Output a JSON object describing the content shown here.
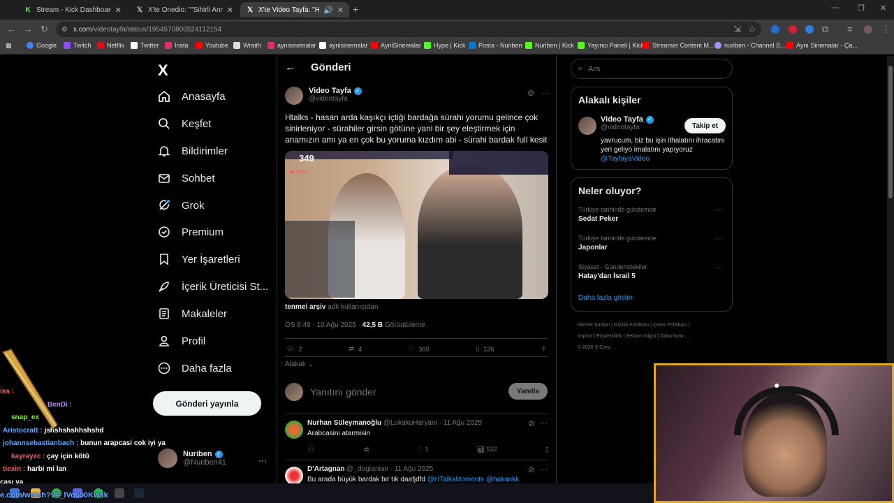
{
  "browser": {
    "tabs": [
      {
        "label": "Stream - Kick Dashboard",
        "favicon": "kick-icon",
        "active": false
      },
      {
        "label": "X'te Onedio: \"\"Sihirli Annem\"in",
        "favicon": "x-icon",
        "active": false
      },
      {
        "label": "X'te Video Tayfa: \"Htalks - h",
        "favicon": "x-icon",
        "active": true
      }
    ],
    "new_tab": "+",
    "url_host": "x.com",
    "url_path": "/videotayfa/status/1954570800524112154",
    "bookmarks": [
      {
        "label": "Google",
        "color": "#4285f4"
      },
      {
        "label": "Twitch",
        "color": "#9146ff"
      },
      {
        "label": "Netflix",
        "color": "#e50914"
      },
      {
        "label": "Twitter",
        "color": "#ffffff"
      },
      {
        "label": "Insta",
        "color": "#e1306c"
      },
      {
        "label": "Youtube",
        "color": "#ff0000"
      },
      {
        "label": "Wraith",
        "color": "#dddddd"
      },
      {
        "label": "aynisinemalar",
        "color": "#e1306c"
      },
      {
        "label": "aynisinemalar",
        "color": "#ffffff"
      },
      {
        "label": "AyniSinemalar",
        "color": "#ff0000"
      },
      {
        "label": "Hype | Kick",
        "color": "#53fc18"
      },
      {
        "label": "Posta - Nuriben",
        "color": "#0078d4"
      },
      {
        "label": "Nuriben | Kick",
        "color": "#53fc18"
      },
      {
        "label": "Yayıncı Paneli | Kick",
        "color": "#53fc18"
      },
      {
        "label": "Streamer Content M...",
        "color": "#ff0000"
      },
      {
        "label": "nuriben - Channel S...",
        "color": "#9999ff"
      },
      {
        "label": "Aynı Sinemalar - Ça...",
        "color": "#ff0000"
      }
    ]
  },
  "sidebar": {
    "logo": "X",
    "items": [
      {
        "label": "Anasayfa",
        "icon": "home-icon"
      },
      {
        "label": "Keşfet",
        "icon": "search-icon"
      },
      {
        "label": "Bildirimler",
        "icon": "bell-icon"
      },
      {
        "label": "Sohbet",
        "icon": "mail-icon"
      },
      {
        "label": "Grok",
        "icon": "grok-icon"
      },
      {
        "label": "Premium",
        "icon": "premium-icon"
      },
      {
        "label": "Yer İşaretleri",
        "icon": "bookmark-icon"
      },
      {
        "label": "İçerik Üreticisi St...",
        "icon": "rocket-icon"
      },
      {
        "label": "Makaleler",
        "icon": "article-icon"
      },
      {
        "label": "Profil",
        "icon": "person-icon"
      },
      {
        "label": "Daha fazla",
        "icon": "more-circle-icon"
      }
    ],
    "post_button": "Gönderi yayınla",
    "account": {
      "name": "Nuriben",
      "handle": "@Nuriben41"
    }
  },
  "main": {
    "header": "Gönderi",
    "tweet": {
      "author": "Video Tayfa",
      "handle": "@videotayfa",
      "text": "Htalks - hasan arda kaşıkçı içtiği bardağa sürahi yorumu gelince çok sinirleniyor - sürahiler girsin götüne yani bir şey eleştirmek için anamızın amı ya en çok bu yoruma kızdım abi - sürahi bardak full kesit",
      "media_viewers": "349",
      "media_by_name": "tenmei arşiv",
      "media_by_suffix": "adlı kullanıcıdan",
      "time": "ÖS 6:49 · 10 Ağu 2025 · ",
      "views": "42,5 B",
      "views_label": "Görüntüleme",
      "replies": "2",
      "reposts": "4",
      "likes": "360",
      "bookmarks": "126"
    },
    "sort": "Alakalı",
    "reply_placeholder": "Yanıtını gönder",
    "reply_button": "Yanıtla",
    "replies": [
      {
        "name": "Nurhan Süleymanoğlu",
        "handle": "@LukakuHaryani · 11 Ağu 2025",
        "text": "Arabcasini atarmisin",
        "replies": "",
        "reposts": "",
        "likes": "1",
        "views": "532"
      },
      {
        "name": "D'Artagnan",
        "handle": "@_dogtanian · 11 Ağu 2025",
        "text": "Bu arada büyük bardak bir tık daafjdfd ",
        "link": "@HTalksMoments @hakankk"
      }
    ]
  },
  "right": {
    "search_placeholder": "Ara",
    "related_title": "Alakalı kişiler",
    "related": {
      "name": "Video Tayfa",
      "handle": "@videotayfa",
      "follow": "Takip et",
      "bio": "yavrucum, biz bu işin ithalatını ihracatını yeri geliyo imalatını yapıyoruz ",
      "bio_link": "@TayfayaVideo"
    },
    "trends_title": "Neler oluyor?",
    "trends": [
      {
        "context": "Türkiye tarihinde gündemde",
        "name": "Sedat Peker"
      },
      {
        "context": "Türkiye tarihinde gündemde",
        "name": "Japonlar"
      },
      {
        "context": "Siyaset · Gündemdekiler",
        "name": "Hatay'dan İsrail 5"
      }
    ],
    "show_more": "Daha fazla göster",
    "footer_line1": "Hizmet Şartları  |  Gizlilik Politikası  |  Çerez Politikası  |",
    "footer_line2": "Imprint  |  Erişilebilirlik  |  Reklam bilgisi  |  Daha fazla ...",
    "footer_line3": "© 2026 X Corp."
  },
  "stream_chat": [
    {
      "user": "",
      "msg": "iss : ",
      "color": "#ff6b6b"
    },
    {
      "user": "BenDi : ",
      "msg": "",
      "color": "#b980ff"
    },
    {
      "user": "snap_ex",
      "msg": "",
      "color": "#7cfc00"
    },
    {
      "user": "Aristocratt : ",
      "msg": "jshshshshhshshd",
      "color": "#5aa9ff"
    },
    {
      "user": "johannsebastianbach : ",
      "msg": "bunun arapcasi cok iyi ya",
      "color": "#5aa9ff"
    },
    {
      "user": "kayrayzc : ",
      "msg": "çay için kötü",
      "color": "#ff5a5a"
    },
    {
      "user": "tiexin : ",
      "msg": "harbi mi lan",
      "color": "#ff5a5a"
    },
    {
      "user": "",
      "msg": "çası ya",
      "color": "#ffffff"
    }
  ],
  "overlay_url": "e.com/watch?v=_lVo690Kwak"
}
